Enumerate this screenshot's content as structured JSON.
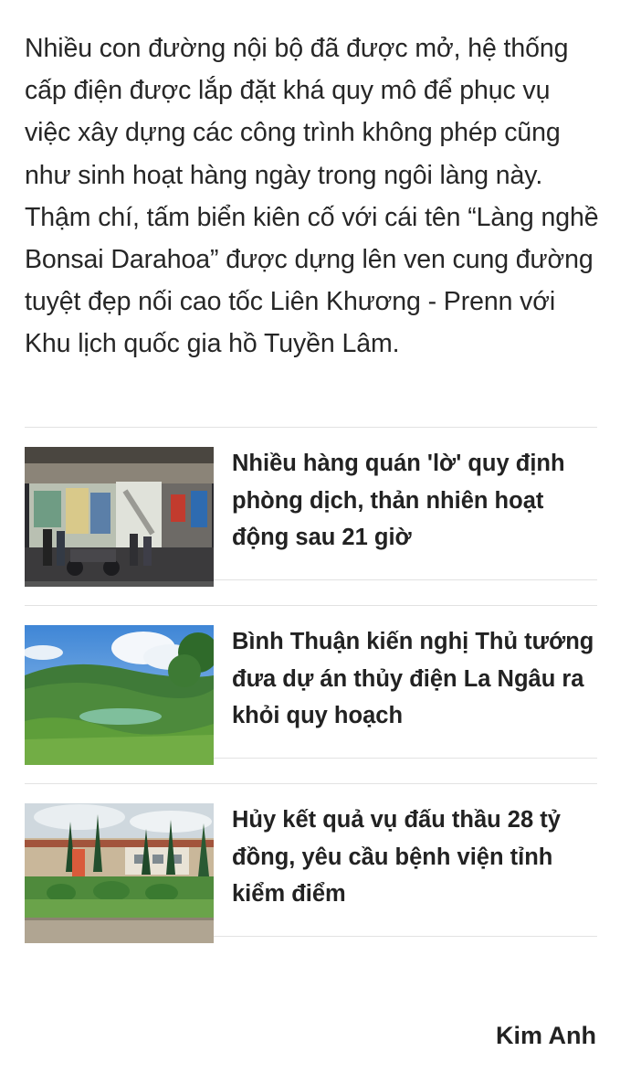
{
  "article": {
    "paragraph": "Nhiều con đường nội bộ đã được mở, hệ thống cấp điện được lắp đặt khá quy mô để phục vụ việc xây dựng các công trình không phép cũng như sinh hoạt hàng ngày trong ngôi làng này. Thậm chí, tấm biển kiên cố với cái tên “Làng nghề Bonsai Darahoa” được dựng lên ven cung đường tuyệt đẹp nối cao tốc Liên Khương - Prenn với Khu lịch quốc gia hồ Tuyền Lâm."
  },
  "related": [
    {
      "title": "Nhiều hàng quán 'lờ' quy định phòng dịch, thản nhiên hoạt động sau 21 giờ",
      "image": "street-shop-night-photo"
    },
    {
      "title": "Bình Thuận kiến nghị Thủ tướng đưa dự án thủy điện La Ngâu ra khỏi quy hoạch",
      "image": "green-hills-lake-photo"
    },
    {
      "title": "Hủy kết quả vụ đấu thầu 28 tỷ đồng, yêu cầu bệnh viện tỉnh kiểm điểm",
      "image": "hospital-gate-photo"
    }
  ],
  "author": "Kim Anh"
}
